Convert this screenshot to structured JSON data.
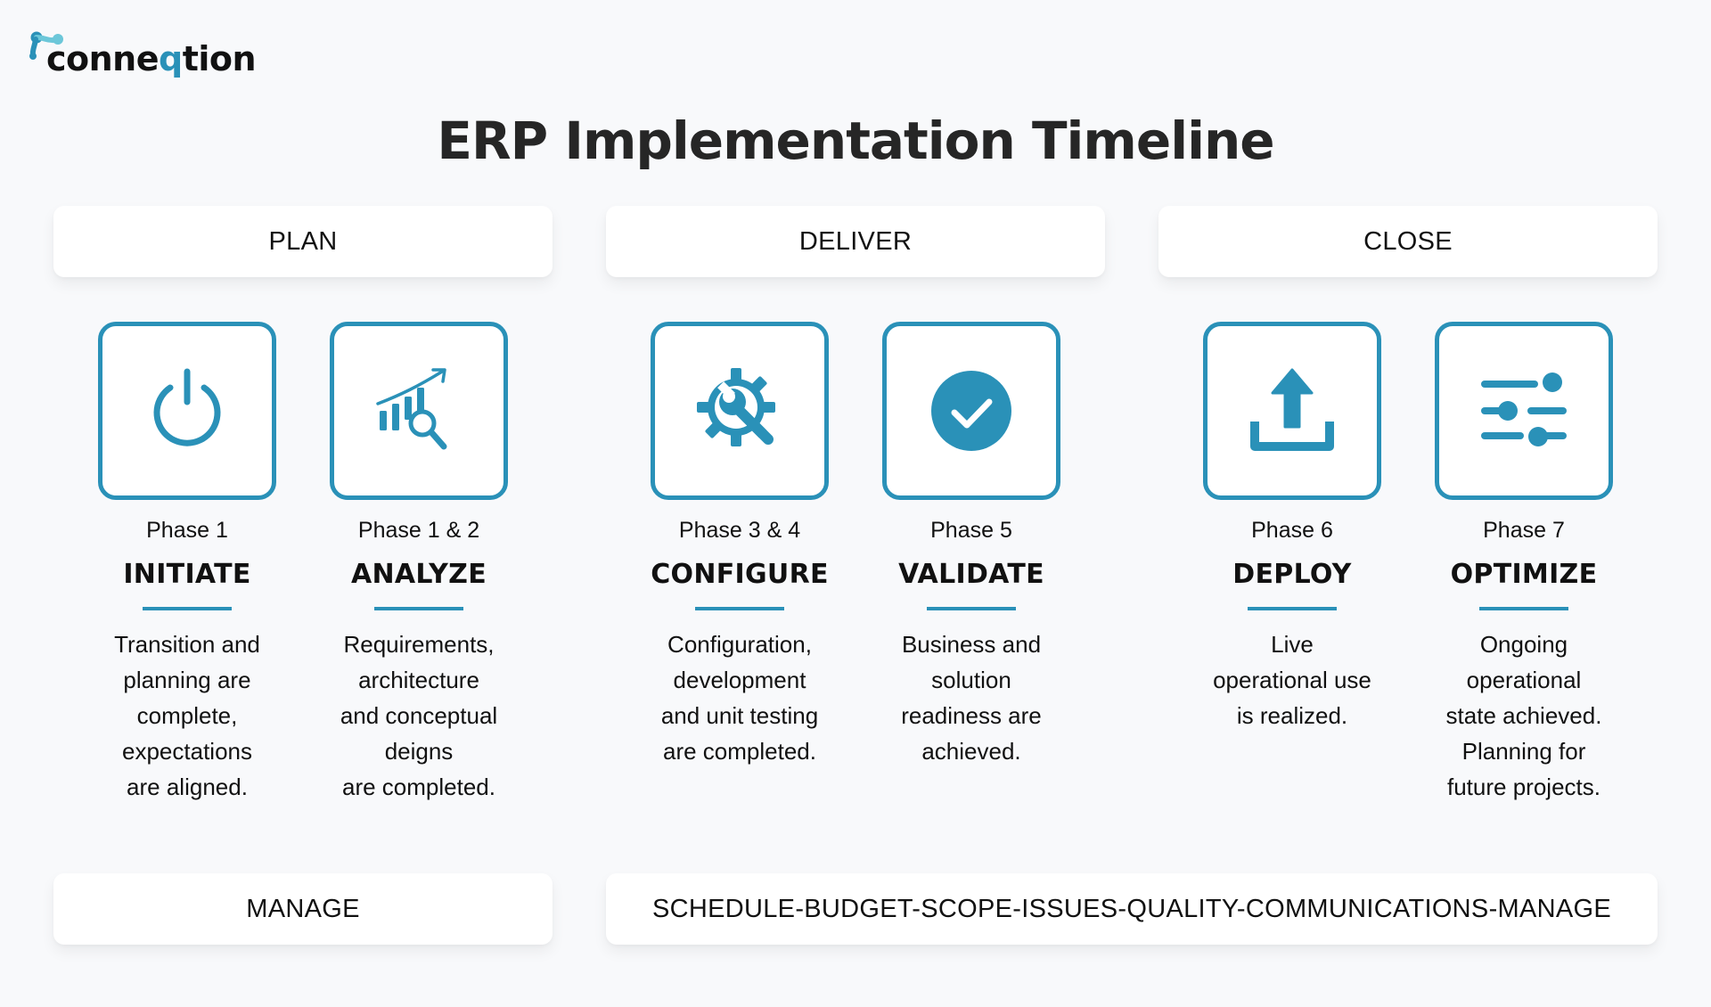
{
  "brand": {
    "name_prefix": "conne",
    "name_accent": "q",
    "name_suffix": "tion",
    "accent_color": "#2a91b8"
  },
  "title": "ERP Implementation Timeline",
  "groups": [
    {
      "label": "PLAN"
    },
    {
      "label": "DELIVER"
    },
    {
      "label": "CLOSE"
    }
  ],
  "phases": [
    {
      "phase": "Phase 1",
      "name": "INITIATE",
      "icon": "power-icon",
      "description": "Transition and\nplanning are\ncomplete,\nexpectations\nare aligned."
    },
    {
      "phase": "Phase 1 & 2",
      "name": "ANALYZE",
      "icon": "chart-search-icon",
      "description": "Requirements,\narchitecture\nand conceptual\ndeigns\nare completed."
    },
    {
      "phase": "Phase 3 & 4",
      "name": "CONFIGURE",
      "icon": "gear-wrench-icon",
      "description": "Configuration,\ndevelopment\nand unit testing\nare completed."
    },
    {
      "phase": "Phase 5",
      "name": "VALIDATE",
      "icon": "check-circle-icon",
      "description": "Business and\nsolution\nreadiness are\nachieved."
    },
    {
      "phase": "Phase 6",
      "name": "DEPLOY",
      "icon": "upload-icon",
      "description": "Live\noperational use\nis realized."
    },
    {
      "phase": "Phase 7",
      "name": "OPTIMIZE",
      "icon": "sliders-icon",
      "description": "Ongoing\noperational\nstate achieved.\nPlanning for\nfuture projects."
    }
  ],
  "footer": {
    "manage_label": "MANAGE",
    "areas_label": "SCHEDULE-BUDGET-SCOPE-ISSUES-QUALITY-COMMUNICATIONS-MANAGE"
  }
}
